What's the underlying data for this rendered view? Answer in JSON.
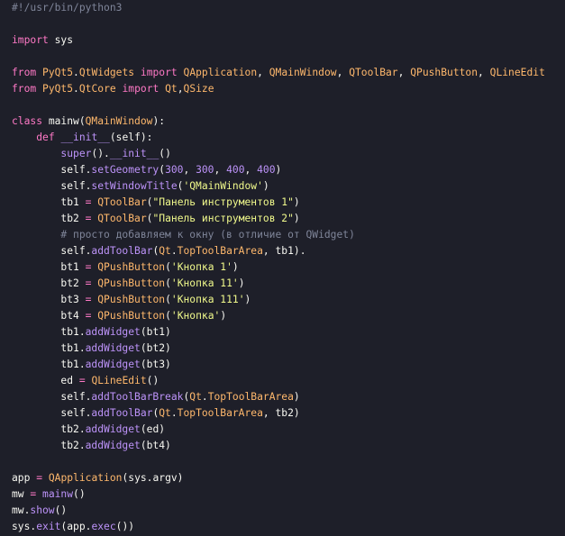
{
  "editor": {
    "theme": {
      "background": "#1e1f29",
      "plain": "#f8f8f2",
      "comment": "#7f8599",
      "keyword": "#ff79c6",
      "class": "#ffb86c",
      "method": "#bd93f9",
      "string": "#f1fa8c"
    },
    "lines": [
      [
        {
          "t": "#!/usr/bin/python3",
          "c": "comment"
        }
      ],
      [],
      [
        {
          "t": "import",
          "c": "keyword"
        },
        {
          "t": " sys",
          "c": "plain"
        }
      ],
      [],
      [
        {
          "t": "from",
          "c": "keyword"
        },
        {
          "t": " ",
          "c": "plain"
        },
        {
          "t": "PyQt5",
          "c": "module"
        },
        {
          "t": ".",
          "c": "plain"
        },
        {
          "t": "QtWidgets",
          "c": "module"
        },
        {
          "t": " ",
          "c": "plain"
        },
        {
          "t": "import",
          "c": "keyword"
        },
        {
          "t": " ",
          "c": "plain"
        },
        {
          "t": "QApplication",
          "c": "class"
        },
        {
          "t": ", ",
          "c": "plain"
        },
        {
          "t": "QMainWindow",
          "c": "class"
        },
        {
          "t": ", ",
          "c": "plain"
        },
        {
          "t": "QToolBar",
          "c": "class"
        },
        {
          "t": ", ",
          "c": "plain"
        },
        {
          "t": "QPushButton",
          "c": "class"
        },
        {
          "t": ", ",
          "c": "plain"
        },
        {
          "t": "QLineEdit",
          "c": "class"
        }
      ],
      [
        {
          "t": "from",
          "c": "keyword"
        },
        {
          "t": " ",
          "c": "plain"
        },
        {
          "t": "PyQt5",
          "c": "module"
        },
        {
          "t": ".",
          "c": "plain"
        },
        {
          "t": "QtCore",
          "c": "module"
        },
        {
          "t": " ",
          "c": "plain"
        },
        {
          "t": "import",
          "c": "keyword"
        },
        {
          "t": " ",
          "c": "plain"
        },
        {
          "t": "Qt",
          "c": "class"
        },
        {
          "t": ",",
          "c": "plain"
        },
        {
          "t": "QSize",
          "c": "class"
        }
      ],
      [],
      [
        {
          "t": "class",
          "c": "keyword"
        },
        {
          "t": " mainw(",
          "c": "plain"
        },
        {
          "t": "QMainWindow",
          "c": "class"
        },
        {
          "t": "):",
          "c": "plain"
        }
      ],
      [
        {
          "t": "    ",
          "c": "plain"
        },
        {
          "t": "def",
          "c": "def"
        },
        {
          "t": " ",
          "c": "plain"
        },
        {
          "t": "__init__",
          "c": "funcname"
        },
        {
          "t": "(self):",
          "c": "plain"
        }
      ],
      [
        {
          "t": "        ",
          "c": "plain"
        },
        {
          "t": "super",
          "c": "method"
        },
        {
          "t": "().",
          "c": "plain"
        },
        {
          "t": "__init__",
          "c": "method"
        },
        {
          "t": "()",
          "c": "plain"
        }
      ],
      [
        {
          "t": "        self.",
          "c": "plain"
        },
        {
          "t": "setGeometry",
          "c": "method"
        },
        {
          "t": "(",
          "c": "plain"
        },
        {
          "t": "300",
          "c": "number"
        },
        {
          "t": ", ",
          "c": "plain"
        },
        {
          "t": "300",
          "c": "number"
        },
        {
          "t": ", ",
          "c": "plain"
        },
        {
          "t": "400",
          "c": "number"
        },
        {
          "t": ", ",
          "c": "plain"
        },
        {
          "t": "400",
          "c": "number"
        },
        {
          "t": ")",
          "c": "plain"
        }
      ],
      [
        {
          "t": "        self.",
          "c": "plain"
        },
        {
          "t": "setWindowTitle",
          "c": "method"
        },
        {
          "t": "(",
          "c": "plain"
        },
        {
          "t": "'QMainWindow'",
          "c": "string"
        },
        {
          "t": ")",
          "c": "plain"
        }
      ],
      [
        {
          "t": "        tb1 ",
          "c": "plain"
        },
        {
          "t": "=",
          "c": "operator"
        },
        {
          "t": " ",
          "c": "plain"
        },
        {
          "t": "QToolBar",
          "c": "class"
        },
        {
          "t": "(",
          "c": "plain"
        },
        {
          "t": "\"Панель инструментов 1\"",
          "c": "string"
        },
        {
          "t": ")",
          "c": "plain"
        }
      ],
      [
        {
          "t": "        tb2 ",
          "c": "plain"
        },
        {
          "t": "=",
          "c": "operator"
        },
        {
          "t": " ",
          "c": "plain"
        },
        {
          "t": "QToolBar",
          "c": "class"
        },
        {
          "t": "(",
          "c": "plain"
        },
        {
          "t": "\"Панель инструментов 2\"",
          "c": "string"
        },
        {
          "t": ")",
          "c": "plain"
        }
      ],
      [
        {
          "t": "        ",
          "c": "plain"
        },
        {
          "t": "# просто добавляем к окну (в отличие от QWidget)",
          "c": "comment"
        }
      ],
      [
        {
          "t": "        self.",
          "c": "plain"
        },
        {
          "t": "addToolBar",
          "c": "method"
        },
        {
          "t": "(",
          "c": "plain"
        },
        {
          "t": "Qt",
          "c": "class"
        },
        {
          "t": ".",
          "c": "plain"
        },
        {
          "t": "TopToolBarArea",
          "c": "class"
        },
        {
          "t": ", tb1).",
          "c": "plain"
        }
      ],
      [
        {
          "t": "        bt1 ",
          "c": "plain"
        },
        {
          "t": "=",
          "c": "operator"
        },
        {
          "t": " ",
          "c": "plain"
        },
        {
          "t": "QPushButton",
          "c": "class"
        },
        {
          "t": "(",
          "c": "plain"
        },
        {
          "t": "'Кнопка 1'",
          "c": "string"
        },
        {
          "t": ")",
          "c": "plain"
        }
      ],
      [
        {
          "t": "        bt2 ",
          "c": "plain"
        },
        {
          "t": "=",
          "c": "operator"
        },
        {
          "t": " ",
          "c": "plain"
        },
        {
          "t": "QPushButton",
          "c": "class"
        },
        {
          "t": "(",
          "c": "plain"
        },
        {
          "t": "'Кнопка 11'",
          "c": "string"
        },
        {
          "t": ")",
          "c": "plain"
        }
      ],
      [
        {
          "t": "        bt3 ",
          "c": "plain"
        },
        {
          "t": "=",
          "c": "operator"
        },
        {
          "t": " ",
          "c": "plain"
        },
        {
          "t": "QPushButton",
          "c": "class"
        },
        {
          "t": "(",
          "c": "plain"
        },
        {
          "t": "'Кнопка 111'",
          "c": "string"
        },
        {
          "t": ")",
          "c": "plain"
        }
      ],
      [
        {
          "t": "        bt4 ",
          "c": "plain"
        },
        {
          "t": "=",
          "c": "operator"
        },
        {
          "t": " ",
          "c": "plain"
        },
        {
          "t": "QPushButton",
          "c": "class"
        },
        {
          "t": "(",
          "c": "plain"
        },
        {
          "t": "'Кнопка'",
          "c": "string"
        },
        {
          "t": ")",
          "c": "plain"
        }
      ],
      [
        {
          "t": "        tb1.",
          "c": "plain"
        },
        {
          "t": "addWidget",
          "c": "method"
        },
        {
          "t": "(bt1)",
          "c": "plain"
        }
      ],
      [
        {
          "t": "        tb1.",
          "c": "plain"
        },
        {
          "t": "addWidget",
          "c": "method"
        },
        {
          "t": "(bt2)",
          "c": "plain"
        }
      ],
      [
        {
          "t": "        tb1.",
          "c": "plain"
        },
        {
          "t": "addWidget",
          "c": "method"
        },
        {
          "t": "(bt3)",
          "c": "plain"
        }
      ],
      [
        {
          "t": "        ed ",
          "c": "plain"
        },
        {
          "t": "=",
          "c": "operator"
        },
        {
          "t": " ",
          "c": "plain"
        },
        {
          "t": "QLineEdit",
          "c": "class"
        },
        {
          "t": "()",
          "c": "plain"
        }
      ],
      [
        {
          "t": "        self.",
          "c": "plain"
        },
        {
          "t": "addToolBarBreak",
          "c": "method"
        },
        {
          "t": "(",
          "c": "plain"
        },
        {
          "t": "Qt",
          "c": "class"
        },
        {
          "t": ".",
          "c": "plain"
        },
        {
          "t": "TopToolBarArea",
          "c": "class"
        },
        {
          "t": ")",
          "c": "plain"
        }
      ],
      [
        {
          "t": "        self.",
          "c": "plain"
        },
        {
          "t": "addToolBar",
          "c": "method"
        },
        {
          "t": "(",
          "c": "plain"
        },
        {
          "t": "Qt",
          "c": "class"
        },
        {
          "t": ".",
          "c": "plain"
        },
        {
          "t": "TopToolBarArea",
          "c": "class"
        },
        {
          "t": ", tb2)",
          "c": "plain"
        }
      ],
      [
        {
          "t": "        tb2.",
          "c": "plain"
        },
        {
          "t": "addWidget",
          "c": "method"
        },
        {
          "t": "(ed)",
          "c": "plain"
        }
      ],
      [
        {
          "t": "        tb2.",
          "c": "plain"
        },
        {
          "t": "addWidget",
          "c": "method"
        },
        {
          "t": "(bt4)",
          "c": "plain"
        }
      ],
      [],
      [
        {
          "t": "app ",
          "c": "plain"
        },
        {
          "t": "=",
          "c": "operator"
        },
        {
          "t": " ",
          "c": "plain"
        },
        {
          "t": "QApplication",
          "c": "class"
        },
        {
          "t": "(sys.argv)",
          "c": "plain"
        }
      ],
      [
        {
          "t": "mw ",
          "c": "plain"
        },
        {
          "t": "=",
          "c": "operator"
        },
        {
          "t": " ",
          "c": "plain"
        },
        {
          "t": "mainw",
          "c": "method"
        },
        {
          "t": "()",
          "c": "plain"
        }
      ],
      [
        {
          "t": "mw.",
          "c": "plain"
        },
        {
          "t": "show",
          "c": "method"
        },
        {
          "t": "()",
          "c": "plain"
        }
      ],
      [
        {
          "t": "sys.",
          "c": "plain"
        },
        {
          "t": "exit",
          "c": "method"
        },
        {
          "t": "(app.",
          "c": "plain"
        },
        {
          "t": "exec",
          "c": "method"
        },
        {
          "t": "())",
          "c": "plain"
        }
      ]
    ]
  }
}
